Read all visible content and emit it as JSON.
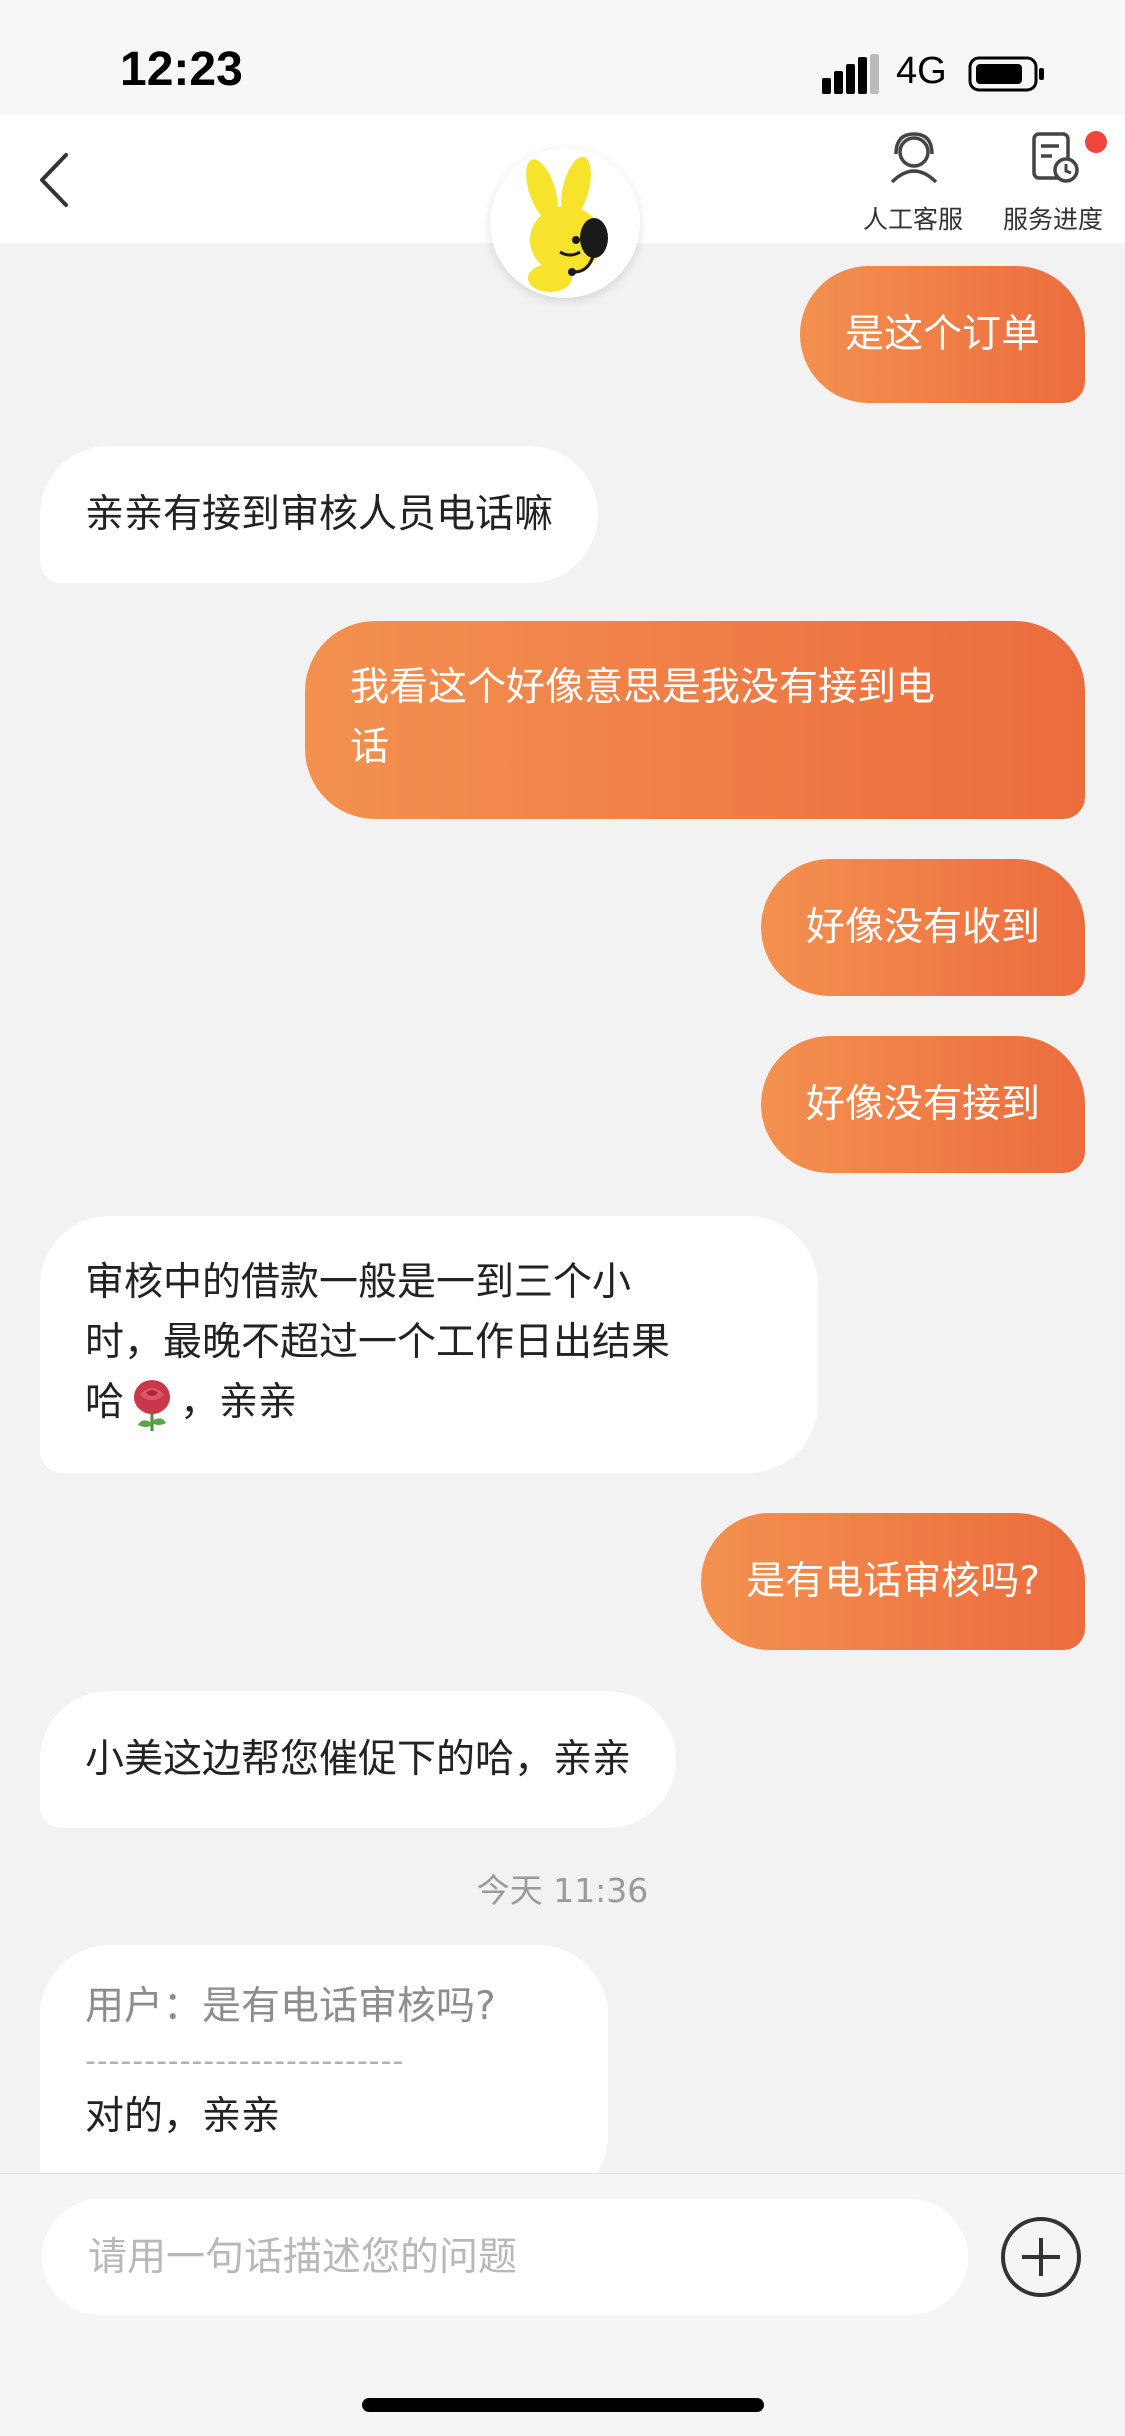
{
  "status_bar": {
    "time": "12:23",
    "network": "4G"
  },
  "header": {
    "human_service_label": "人工客服",
    "service_progress_label": "服务进度"
  },
  "messages": [
    {
      "side": "out",
      "text": "是这个订单"
    },
    {
      "side": "in",
      "text": "亲亲有接到审核人员电话嘛"
    },
    {
      "side": "out",
      "lines": [
        "我看这个好像意思是我没有接到电",
        "话"
      ]
    },
    {
      "side": "out",
      "text": "好像没有收到"
    },
    {
      "side": "out",
      "text": "好像没有接到"
    },
    {
      "side": "in",
      "lines": [
        "审核中的借款一般是一到三个小",
        "时，最晚不超过一个工作日出结果",
        "哈"
      ],
      "tail": "，亲亲"
    },
    {
      "side": "out",
      "text": "是有电话审核吗?"
    },
    {
      "side": "in",
      "text": "小美这边帮您催促下的哈，亲亲"
    },
    {
      "side": "in",
      "quote": "用户：是有电话审核吗?",
      "divider": "---------------------------",
      "reply": "对的，亲亲"
    }
  ],
  "timestamp": "今天 11:36",
  "input": {
    "placeholder": "请用一句话描述您的问题"
  },
  "colors": {
    "accent_start": "#f39150",
    "accent_end": "#ec6c3e",
    "badge": "#f0453a"
  },
  "icons": [
    "back-arrow-icon",
    "headset-icon",
    "service-progress-icon",
    "plus-icon",
    "rose-emoji-icon",
    "mascot-icon"
  ]
}
